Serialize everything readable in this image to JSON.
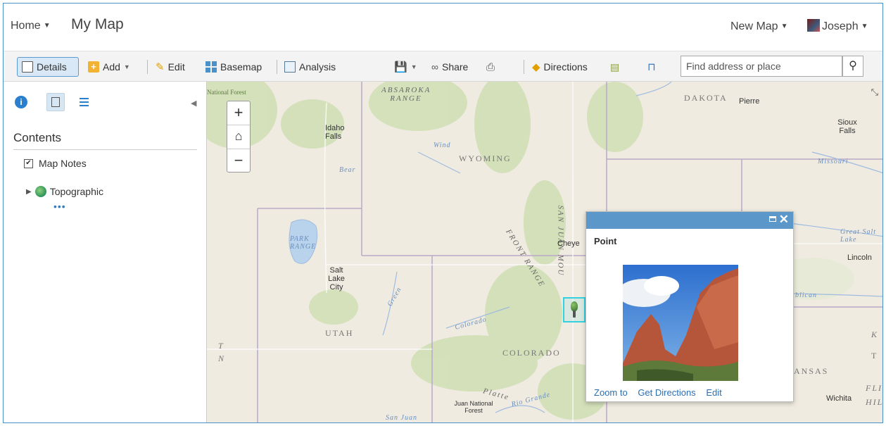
{
  "header": {
    "home_label": "Home",
    "map_title": "My Map",
    "new_map_label": "New Map",
    "user_name": "Joseph"
  },
  "toolbar": {
    "details_label": "Details",
    "add_label": "Add",
    "edit_label": "Edit",
    "basemap_label": "Basemap",
    "analysis_label": "Analysis",
    "share_label": "Share",
    "directions_label": "Directions",
    "search_placeholder": "Find address or place"
  },
  "panel": {
    "contents_heading": "Contents",
    "layers": [
      {
        "label": "Map Notes",
        "checked": true
      },
      {
        "label": "Topographic"
      }
    ],
    "more_dots": "•••"
  },
  "map": {
    "states": [
      "WYOMING",
      "UTAH",
      "COLORADO",
      "DAKOTA",
      "ANSAS"
    ],
    "cities": [
      "Idaho Falls",
      "Salt Lake City",
      "Pierre",
      "Sioux Falls",
      "Lincoln",
      "Wichita",
      "Cheye"
    ],
    "features": [
      "ABSAROKA RANGE",
      "Great Salt Lake",
      "PARK RANGE",
      "FRONT RANGE",
      "SAN JUAN MOU",
      "Missouri",
      "Platte",
      "Colorado",
      "Green",
      "Rio Grande",
      "Wind",
      "Bear",
      "Juan National Forest"
    ],
    "edge_text": {
      "left_top": "National Forest",
      "t_left": "T",
      "n_left": "N",
      "k_right": "K",
      "t_right": "T",
      "fli": "FLI",
      "hil": "HIL",
      "blican": "blican",
      "san": "San",
      "san_juan": "San Juan"
    },
    "zoom_in": "+",
    "zoom_out": "−"
  },
  "popup": {
    "title": "Point",
    "links": [
      "Zoom to",
      "Get Directions",
      "Edit"
    ]
  },
  "colors": {
    "accent": "#5b98c9",
    "link": "#2a6fb5",
    "selection": "#34d0e0",
    "border": "#4a90c9"
  }
}
